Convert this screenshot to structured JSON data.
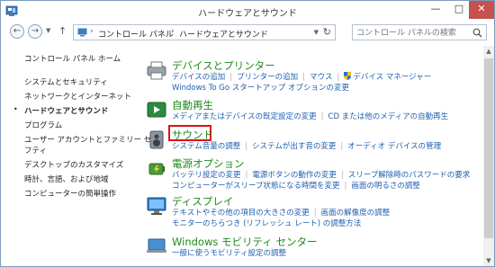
{
  "window": {
    "title": "ハードウェアとサウンド",
    "minimize_glyph": "—",
    "maximize_glyph": "□",
    "close_glyph": "✕"
  },
  "address": {
    "back_glyph": "←",
    "forward_glyph": "→",
    "up_glyph": "↑",
    "separator": "›",
    "crumbs": [
      "コントロール パネル",
      "ハードウェアとサウンド"
    ],
    "refresh_glyph": "↻"
  },
  "search": {
    "placeholder": "コントロール パネルの検索"
  },
  "sidebar": {
    "items": [
      {
        "label": "コントロール パネル ホーム"
      },
      {
        "label": "システムとセキュリティ"
      },
      {
        "label": "ネットワークとインターネット"
      },
      {
        "label": "ハードウェアとサウンド",
        "current": true
      },
      {
        "label": "プログラム"
      },
      {
        "label": "ユーザー アカウントとファミリー セー"
      },
      {
        "label": "フティ"
      },
      {
        "label": "デスクトップのカスタマイズ"
      },
      {
        "label": "時計、言語、および地域"
      },
      {
        "label": "コンピューターの簡単操作"
      }
    ],
    "current_bullet": "•"
  },
  "categories": [
    {
      "title": "デバイスとプリンター",
      "links": [
        [
          "デバイスの追加",
          "プリンターの追加",
          "マウス",
          "デバイス マネージャー"
        ],
        [
          "Windows To Go スタートアップ オプションの変更"
        ]
      ]
    },
    {
      "title": "自動再生",
      "links": [
        [
          "メディアまたはデバイスの既定設定の変更",
          "CD または他のメディアの自動再生"
        ]
      ]
    },
    {
      "title": "サウンド",
      "highlighted": true,
      "links": [
        [
          "システム音量の調整",
          "システムが出す音の変更",
          "オーディオ デバイスの管理"
        ]
      ]
    },
    {
      "title": "電源オプション",
      "links": [
        [
          "バッテリ設定の変更",
          "電源ボタンの動作の変更",
          "スリープ解除時のパスワードの要求"
        ],
        [
          "コンピューターがスリープ状態になる時間を変更",
          "画面の明るさの調整"
        ]
      ]
    },
    {
      "title": "ディスプレイ",
      "links": [
        [
          "テキストやその他の項目の大きさの変更",
          "画面の解像度の調整"
        ],
        [
          "モニターのちらつき (リフレッシュ レート) の調整方法"
        ]
      ]
    },
    {
      "title": "Windows モビリティ センター",
      "links": [
        [
          "一般に使うモビリティ設定の調整"
        ]
      ]
    }
  ],
  "icons": {
    "app": "control-panel-icon",
    "search": "search-icon",
    "shield": "uac-shield-icon"
  },
  "colors": {
    "category_title": "#1f8a1f",
    "link": "#1f5fb0",
    "highlight_box": "#e0101a",
    "close_button": "#c75050"
  }
}
